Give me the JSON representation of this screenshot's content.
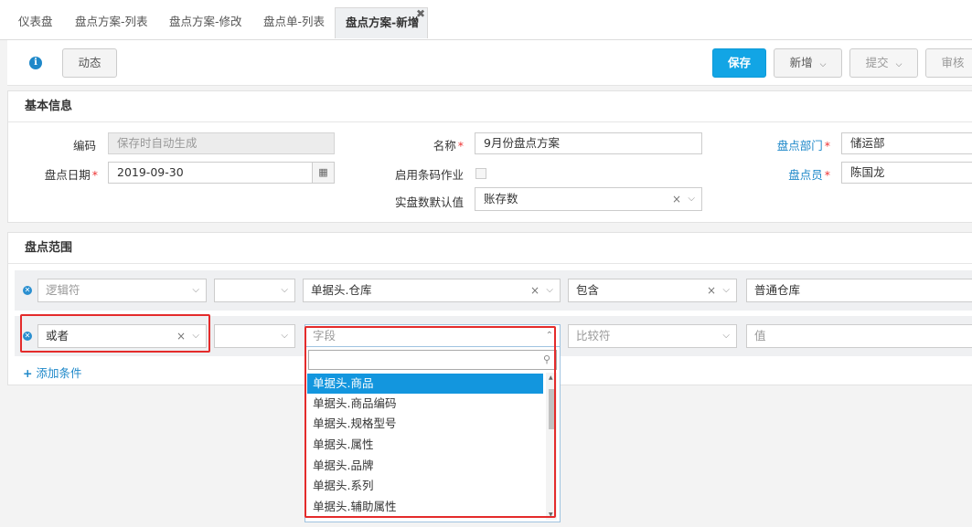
{
  "tabs": [
    {
      "label": "仪表盘"
    },
    {
      "label": "盘点方案-列表"
    },
    {
      "label": "盘点方案-修改"
    },
    {
      "label": "盘点单-列表"
    },
    {
      "label": "盘点方案-新增",
      "active": true
    }
  ],
  "toolbar": {
    "dynamic": "动态",
    "save": "保存",
    "add": "新增",
    "submit": "提交",
    "audit": "审核"
  },
  "basic": {
    "title": "基本信息",
    "code_label": "编码",
    "code_placeholder": "保存时自动生成",
    "name_label": "名称",
    "name_value": "9月份盘点方案",
    "dept_label": "盘点部门",
    "dept_value": "储运部",
    "date_label": "盘点日期",
    "date_value": "2019-09-30",
    "barcode_label": "启用条码作业",
    "clerk_label": "盘点员",
    "clerk_value": "陈国龙",
    "default_label": "实盘数默认值",
    "default_value": "账存数"
  },
  "scope": {
    "title": "盘点范围",
    "row1": {
      "logic": "逻辑符",
      "field": "单据头.仓库",
      "op": "包含",
      "value": "普通仓库"
    },
    "row2": {
      "logic": "或者",
      "field": "字段",
      "op": "比较符",
      "value": "值"
    },
    "add_condition": "添加条件"
  },
  "dropdown": {
    "items": [
      "单据头.商品",
      "单据头.商品编码",
      "单据头.规格型号",
      "单据头.属性",
      "单据头.品牌",
      "单据头.系列",
      "单据头.辅助属性"
    ],
    "selected_index": 0
  }
}
